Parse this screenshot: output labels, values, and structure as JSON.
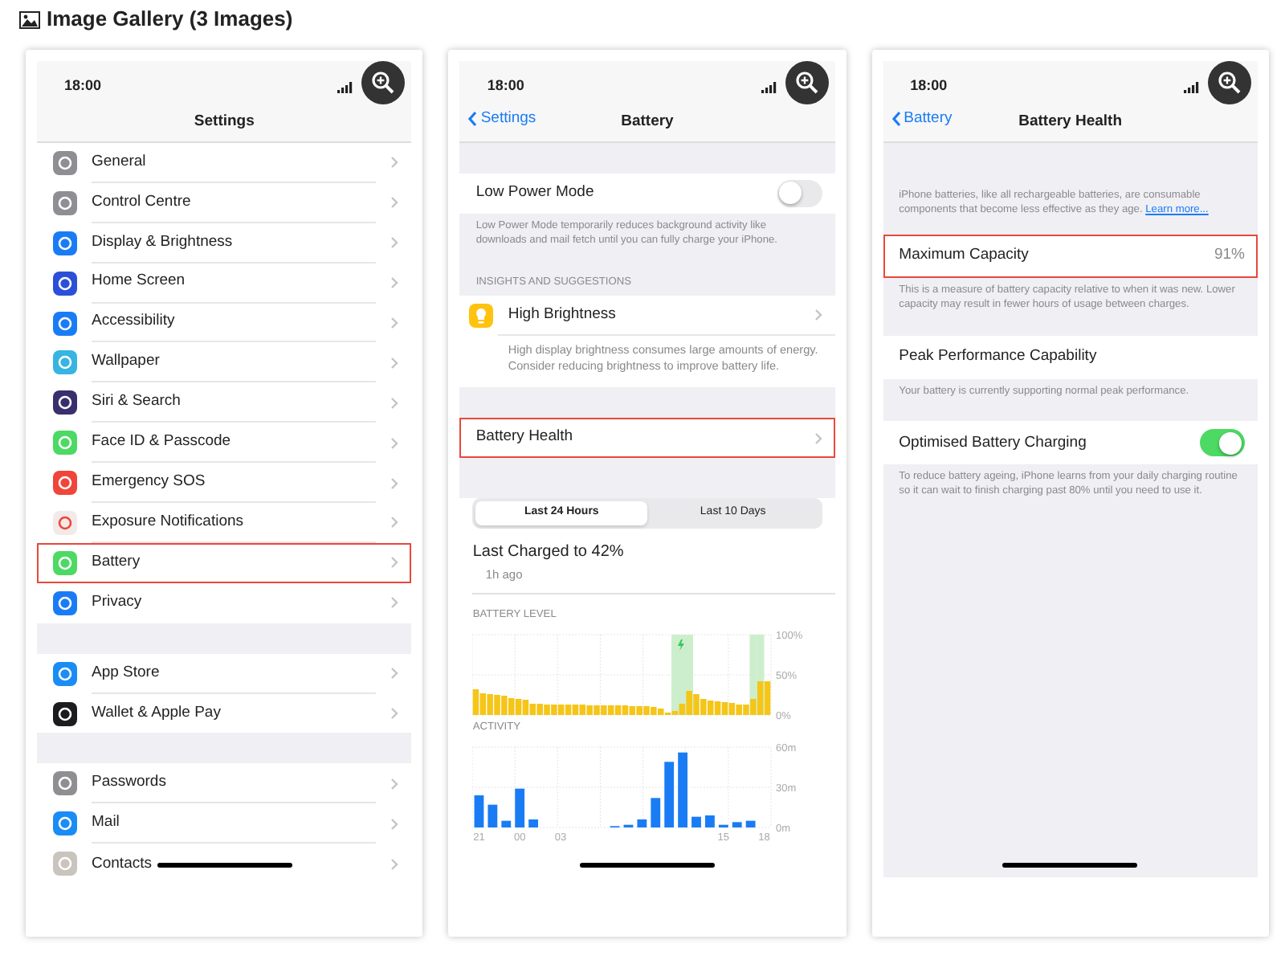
{
  "heading": "Image Gallery (3 Images)",
  "screens": [
    {
      "kind": "settings",
      "time": "18:00",
      "title": "Settings",
      "groups": [
        [
          {
            "label": "General",
            "color": "#8e8e93",
            "highlighted": false
          },
          {
            "label": "Control Centre",
            "color": "#8e8e93",
            "highlighted": false
          },
          {
            "label": "Display & Brightness",
            "color": "#1a7cf5",
            "highlighted": false
          },
          {
            "label": "Home Screen",
            "color": "#2b4fd8",
            "highlighted": false
          },
          {
            "label": "Accessibility",
            "color": "#1a7cf5",
            "highlighted": false
          },
          {
            "label": "Wallpaper",
            "color": "#36b4e2",
            "highlighted": false
          },
          {
            "label": "Siri & Search",
            "color": "#3a2f6e",
            "highlighted": false
          },
          {
            "label": "Face ID & Passcode",
            "color": "#4cd964",
            "highlighted": false
          },
          {
            "label": "Emergency SOS",
            "color": "#f0453a",
            "highlighted": false
          },
          {
            "label": "Exposure Notifications",
            "color": "#f2e9e9",
            "highlighted": false
          },
          {
            "label": "Battery",
            "color": "#4cd964",
            "highlighted": true
          },
          {
            "label": "Privacy",
            "color": "#1a7cf5",
            "highlighted": false
          }
        ],
        [
          {
            "label": "App Store",
            "color": "#1a8cf5",
            "highlighted": false
          },
          {
            "label": "Wallet & Apple Pay",
            "color": "#1c1c1e",
            "highlighted": false
          }
        ],
        [
          {
            "label": "Passwords",
            "color": "#8e8e93",
            "highlighted": false
          },
          {
            "label": "Mail",
            "color": "#1a8cf5",
            "highlighted": false
          },
          {
            "label": "Contacts",
            "color": "#c9c4bd",
            "highlighted": false
          }
        ]
      ]
    },
    {
      "kind": "battery",
      "time": "18:00",
      "back": "Settings",
      "title": "Battery",
      "low_power": {
        "label": "Low Power Mode",
        "on": false,
        "footer": "Low Power Mode temporarily reduces background activity like downloads and mail fetch until you can fully charge your iPhone."
      },
      "insights_header": "INSIGHTS AND SUGGESTIONS",
      "insight": {
        "label": "High Brightness",
        "text": "High display brightness consumes large amounts of energy. Consider reducing brightness to improve battery life."
      },
      "health_row": {
        "label": "Battery Health",
        "highlighted": true
      },
      "segments": [
        {
          "label": "Last 24 Hours",
          "selected": true
        },
        {
          "label": "Last 10 Days",
          "selected": false
        }
      ],
      "last_charged": "Last Charged to 42%",
      "ago": "1h ago",
      "battery_level": {
        "chart_data": {
          "type": "bar",
          "title": "BATTERY LEVEL",
          "ylim": [
            0,
            100
          ],
          "categories": [
            null,
            null,
            null,
            null,
            null,
            null,
            null,
            null,
            null,
            null,
            null,
            null,
            null,
            null,
            null,
            null,
            null,
            null,
            null,
            null,
            null,
            null,
            null,
            null,
            null,
            null,
            null,
            null,
            null,
            null,
            null,
            null,
            null,
            null,
            null,
            null,
            null,
            null,
            null,
            null,
            null,
            null
          ],
          "values": [
            32,
            27,
            26,
            25,
            24,
            21,
            20,
            19,
            14,
            14,
            13,
            13,
            13,
            13,
            13,
            13,
            12,
            12,
            12,
            12,
            12,
            12,
            11,
            11,
            11,
            10,
            8,
            3,
            5,
            14,
            30,
            26,
            20,
            18,
            17,
            16,
            15,
            13,
            13,
            20,
            42,
            42
          ],
          "yticks": [
            {
              "value": 0,
              "label": "0%"
            },
            {
              "value": 50,
              "label": "50%"
            },
            {
              "value": 100,
              "label": "100%"
            }
          ],
          "grid": true
        },
        "charging": [
          false,
          false,
          false,
          false,
          false,
          false,
          false,
          false,
          false,
          false,
          false,
          false,
          false,
          false,
          false,
          false,
          false,
          false,
          false,
          false,
          false,
          false,
          false,
          false,
          false,
          false,
          false,
          false,
          true,
          true,
          true,
          false,
          false,
          false,
          false,
          false,
          false,
          false,
          false,
          true,
          true,
          false
        ]
      },
      "activity": {
        "chart_data": {
          "type": "bar",
          "title": "ACTIVITY",
          "ylim": [
            0,
            60
          ],
          "grid": true,
          "categories": [
            "21",
            null,
            null,
            "00",
            null,
            null,
            "03",
            null,
            null,
            null,
            null,
            null,
            null,
            null,
            null,
            null,
            null,
            null,
            "15",
            null,
            null,
            "18"
          ],
          "values": [
            24,
            17,
            5,
            29,
            6,
            0,
            0,
            0,
            0,
            0,
            1,
            2,
            6,
            22,
            49,
            56,
            8,
            9,
            2,
            4,
            5,
            null
          ],
          "yticks": [
            {
              "value": 0,
              "label": "0m"
            },
            {
              "value": 30,
              "label": "30m"
            },
            {
              "value": 60,
              "label": "60m"
            }
          ]
        }
      }
    },
    {
      "kind": "health",
      "time": "18:00",
      "back": "Battery",
      "title": "Battery Health",
      "intro": "iPhone batteries, like all rechargeable batteries, are consumable components that become less effective as they age.",
      "learn_more": "Learn more...",
      "rows": [
        {
          "kind": "value",
          "label": "Maximum Capacity",
          "value": "91%",
          "highlighted": true,
          "footer": "This is a measure of battery capacity relative to when it was new. Lower capacity may result in fewer hours of usage between charges."
        },
        {
          "kind": "plain",
          "label": "Peak Performance Capability",
          "highlighted": false,
          "footer": "Your battery is currently supporting normal peak performance."
        },
        {
          "kind": "toggle",
          "label": "Optimised Battery Charging",
          "on": true,
          "highlighted": false,
          "footer": "To reduce battery ageing, iPhone learns from your daily charging routine so it can wait to finish charging past 80% until you need to use it."
        }
      ]
    }
  ]
}
